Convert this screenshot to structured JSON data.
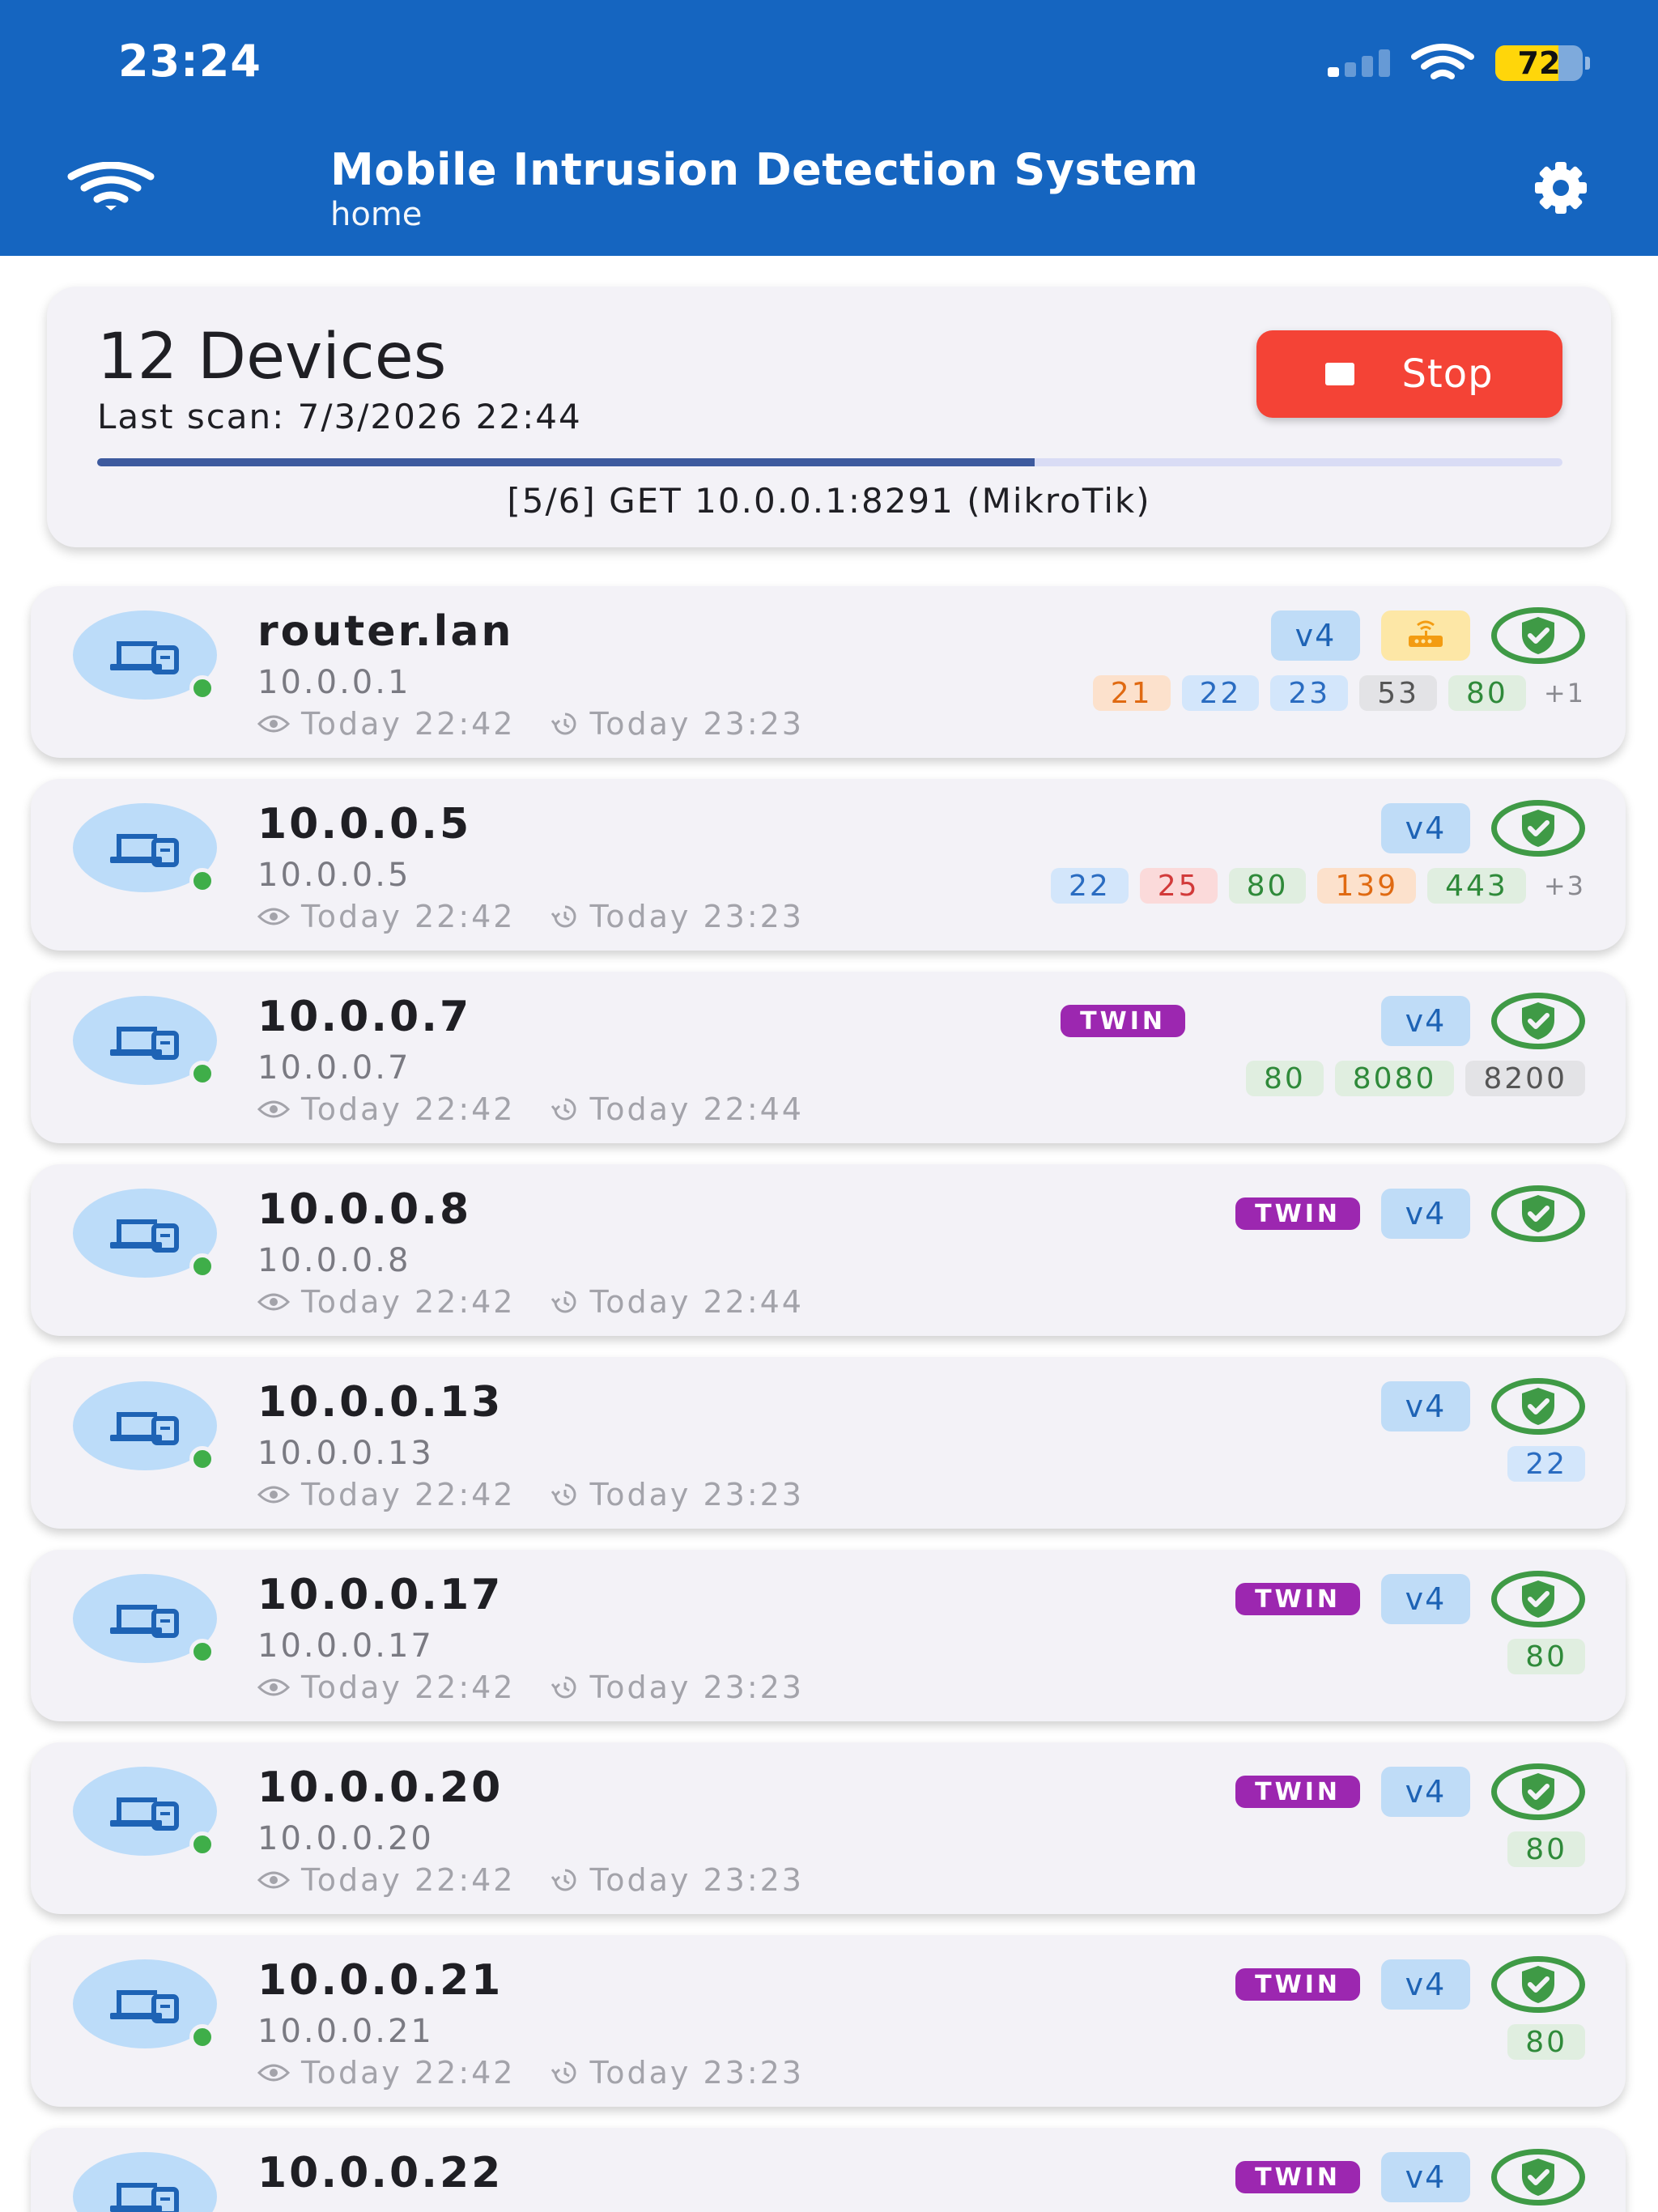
{
  "status_bar": {
    "time": "23:24",
    "battery": "72",
    "battery_level": 0.72
  },
  "header": {
    "title": "Mobile Intrusion Detection System",
    "subtitle": "home"
  },
  "summary": {
    "devices_label": "12 Devices",
    "last_scan": "Last scan: 7/3/2026 22:44",
    "stop_label": "Stop",
    "progress": 0.64,
    "scan_step": "[5/6] GET 10.0.0.1:8291 (MikroTik)"
  },
  "colors": {
    "appbar": "#1565c0",
    "stop": "#f44336",
    "twin": "#9c27b0",
    "online": "#3fae49",
    "shield": "#3f9a46"
  },
  "devices": [
    {
      "name": "router.lan",
      "ip": "10.0.0.1",
      "first_seen": "Today 22:42",
      "last_seen": "Today 23:23",
      "v4": "v4",
      "twin": "",
      "router": true,
      "ports": [
        {
          "label": "21",
          "color": "orange"
        },
        {
          "label": "22",
          "color": "blue"
        },
        {
          "label": "23",
          "color": "blue"
        },
        {
          "label": "53",
          "color": "gray"
        },
        {
          "label": "80",
          "color": "green"
        }
      ],
      "more": "+1"
    },
    {
      "name": "10.0.0.5",
      "ip": "10.0.0.5",
      "first_seen": "Today 22:42",
      "last_seen": "Today 23:23",
      "v4": "v4",
      "twin": "",
      "router": false,
      "ports": [
        {
          "label": "22",
          "color": "blue"
        },
        {
          "label": "25",
          "color": "red"
        },
        {
          "label": "80",
          "color": "green"
        },
        {
          "label": "139",
          "color": "orange"
        },
        {
          "label": "443",
          "color": "green"
        }
      ],
      "more": "+3"
    },
    {
      "name": "10.0.0.7",
      "ip": "10.0.0.7",
      "first_seen": "Today 22:42",
      "last_seen": "Today 22:44",
      "v4": "v4",
      "twin": "TWIN",
      "twin_pos": "left",
      "router": false,
      "ports": [
        {
          "label": "80",
          "color": "green"
        },
        {
          "label": "8080",
          "color": "green"
        },
        {
          "label": "8200",
          "color": "gray"
        }
      ],
      "more": ""
    },
    {
      "name": "10.0.0.8",
      "ip": "10.0.0.8",
      "first_seen": "Today 22:42",
      "last_seen": "Today 22:44",
      "v4": "v4",
      "twin": "TWIN",
      "router": false,
      "ports": [],
      "more": ""
    },
    {
      "name": "10.0.0.13",
      "ip": "10.0.0.13",
      "first_seen": "Today 22:42",
      "last_seen": "Today 23:23",
      "v4": "v4",
      "twin": "",
      "router": false,
      "ports": [
        {
          "label": "22",
          "color": "blue"
        }
      ],
      "more": ""
    },
    {
      "name": "10.0.0.17",
      "ip": "10.0.0.17",
      "first_seen": "Today 22:42",
      "last_seen": "Today 23:23",
      "v4": "v4",
      "twin": "TWIN",
      "router": false,
      "ports": [
        {
          "label": "80",
          "color": "green"
        }
      ],
      "more": ""
    },
    {
      "name": "10.0.0.20",
      "ip": "10.0.0.20",
      "first_seen": "Today 22:42",
      "last_seen": "Today 23:23",
      "v4": "v4",
      "twin": "TWIN",
      "router": false,
      "ports": [
        {
          "label": "80",
          "color": "green"
        }
      ],
      "more": ""
    },
    {
      "name": "10.0.0.21",
      "ip": "10.0.0.21",
      "first_seen": "Today 22:42",
      "last_seen": "Today 23:23",
      "v4": "v4",
      "twin": "TWIN",
      "router": false,
      "ports": [
        {
          "label": "80",
          "color": "green"
        }
      ],
      "more": ""
    },
    {
      "name": "10.0.0.22",
      "ip": "",
      "first_seen": "",
      "last_seen": "",
      "v4": "v4",
      "twin": "TWIN",
      "router": false,
      "ports": [],
      "more": ""
    }
  ]
}
